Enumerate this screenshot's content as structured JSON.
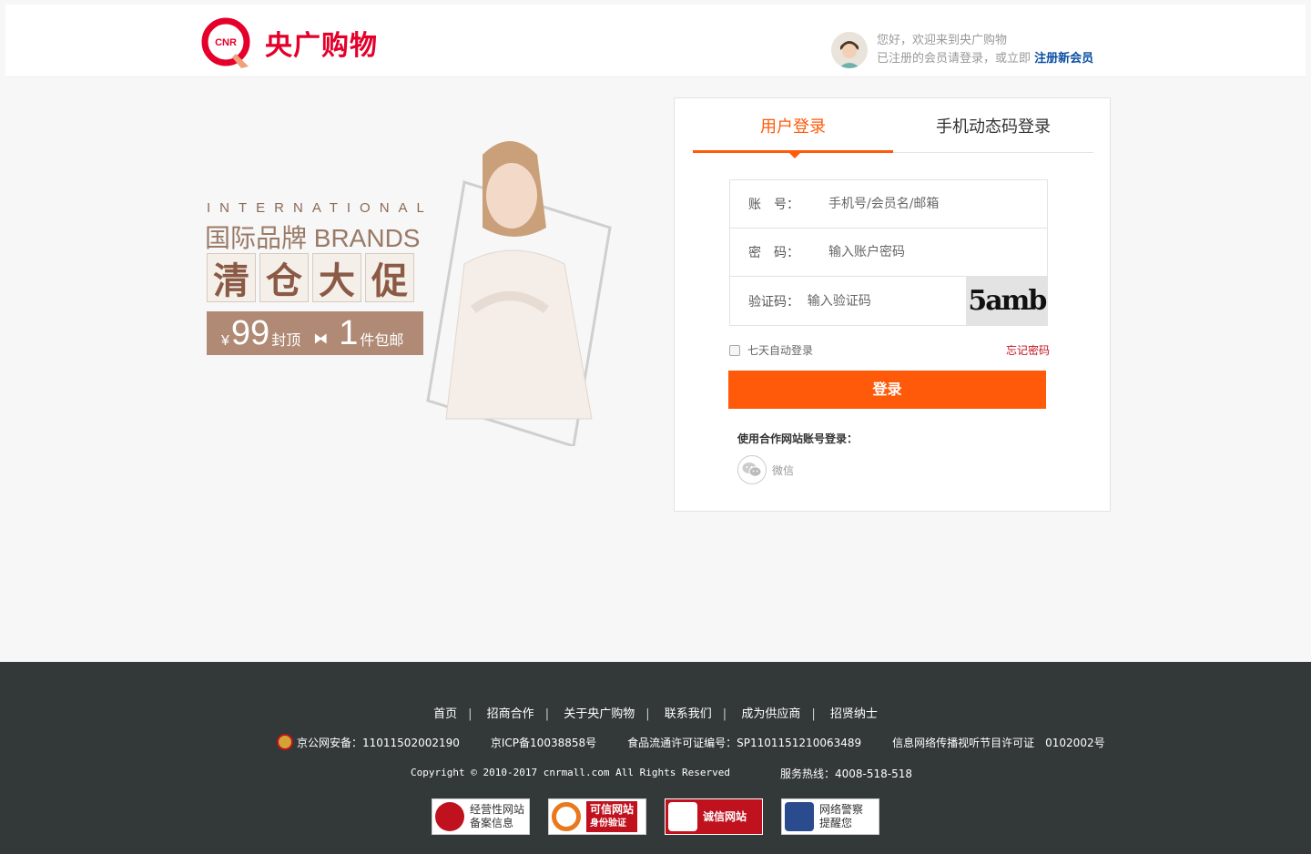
{
  "header": {
    "logo_badge": "CNR",
    "logo_text": "央广购物",
    "welcome_line1": "您好，欢迎来到央广购物",
    "welcome_line2": "已注册的会员请登录，或立即",
    "register_link": "注册新会员"
  },
  "banner": {
    "en_title": "INTERNATIONAL",
    "brand_title": "国际品牌 BRANDS",
    "promo_chars": [
      "清",
      "仓",
      "大",
      "促"
    ],
    "price_symbol": "¥",
    "price": "99",
    "price_suffix": "封顶",
    "bundle_count": "1",
    "bundle_suffix": "件包邮"
  },
  "login": {
    "tabs": [
      {
        "label": "用户登录",
        "active": true
      },
      {
        "label": "手机动态码登录",
        "active": false
      }
    ],
    "fields": {
      "account_label": "账　号：",
      "account_placeholder": "手机号/会员名/邮箱",
      "password_label": "密　码：",
      "password_placeholder": "输入账户密码",
      "captcha_label": "验证码：",
      "captcha_placeholder": "输入验证码",
      "captcha_text": "5amb"
    },
    "remember_label": "七天自动登录",
    "forgot_label": "忘记密码",
    "submit_label": "登录",
    "partner_title": "使用合作网站账号登录：",
    "wechat_label": "微信"
  },
  "footer": {
    "nav": [
      "首页",
      "招商合作",
      "关于央广购物",
      "联系我们",
      "成为供应商",
      "招贤纳士"
    ],
    "nav_separator": "|",
    "police_record": "京公网安备：11011502002190",
    "icp_record": "京ICP备10038858号",
    "food_license": "食品流通许可证编号：SP1101151210063489",
    "av_license": "信息网络传播视听节目许可证　0102002号",
    "copyright": "Copyright © 2010-2017  cnrmall.com  All  Rights  Reserved",
    "hotline": "服务热线：4008-518-518",
    "badges": [
      {
        "line1": "经营性网站",
        "line2": "备案信息",
        "icon": "emblem-icon",
        "color": "#c0121e"
      },
      {
        "line1": "可信网站",
        "line2": "身份验证",
        "icon": "trusted-site-icon",
        "color": "#e8791e"
      },
      {
        "line1": "诚信网站",
        "line2": "",
        "icon": "integrity-icon",
        "color": "#c0121e"
      },
      {
        "line1": "网络警察",
        "line2": "提醒您",
        "icon": "police-icon",
        "color": "#2a4b8d"
      }
    ]
  },
  "colors": {
    "brand_red": "#e4002b",
    "accent_orange": "#ff5a0a",
    "footer_bg": "#333839",
    "link_blue": "#0b4ea2"
  }
}
